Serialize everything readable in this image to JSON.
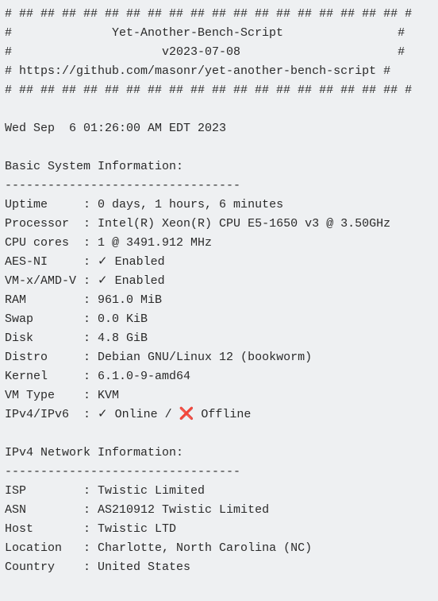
{
  "header": {
    "border": "# ## ## ## ## ## ## ## ## ## ## ## ## ## ## ## ## ## ## #",
    "title_line": "#              Yet-Another-Bench-Script                #",
    "version_line": "#                     v2023-07-08                      #",
    "url_line": "# https://github.com/masonr/yet-another-bench-script #"
  },
  "timestamp": "Wed Sep  6 01:26:00 AM EDT 2023",
  "basic_info": {
    "heading": "Basic System Information:",
    "divider": "---------------------------------",
    "rows": [
      {
        "label": "Uptime     :",
        "value": " 0 days, 1 hours, 6 minutes"
      },
      {
        "label": "Processor  :",
        "value": " Intel(R) Xeon(R) CPU E5-1650 v3 @ 3.50GHz"
      },
      {
        "label": "CPU cores  :",
        "value": " 1 @ 3491.912 MHz"
      },
      {
        "label": "AES-NI     :",
        "value": " ✓ Enabled"
      },
      {
        "label": "VM-x/AMD-V :",
        "value": " ✓ Enabled"
      },
      {
        "label": "RAM        :",
        "value": " 961.0 MiB"
      },
      {
        "label": "Swap       :",
        "value": " 0.0 KiB"
      },
      {
        "label": "Disk       :",
        "value": " 4.8 GiB"
      },
      {
        "label": "Distro     :",
        "value": " Debian GNU/Linux 12 (bookworm)"
      },
      {
        "label": "Kernel     :",
        "value": " 6.1.0-9-amd64"
      },
      {
        "label": "VM Type    :",
        "value": " KVM"
      }
    ],
    "ipv_row": {
      "label": "IPv4/IPv6  :",
      "ipv4_check": " ✓ ",
      "ipv4_text": "Online / ",
      "ipv6_cross": "❌ ",
      "ipv6_text": "Offline"
    }
  },
  "ipv4_info": {
    "heading": "IPv4 Network Information:",
    "divider": "---------------------------------",
    "rows": [
      {
        "label": "ISP        :",
        "value": " Twistic Limited"
      },
      {
        "label": "ASN        :",
        "value": " AS210912 Twistic Limited"
      },
      {
        "label": "Host       :",
        "value": " Twistic LTD"
      },
      {
        "label": "Location   :",
        "value": " Charlotte, North Carolina (NC)"
      },
      {
        "label": "Country    :",
        "value": " United States"
      }
    ]
  }
}
